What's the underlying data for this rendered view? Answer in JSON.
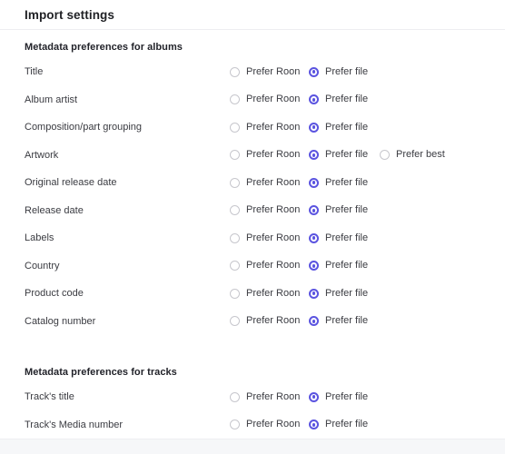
{
  "header": {
    "title": "Import settings"
  },
  "sections": [
    {
      "heading": "Metadata preferences for albums",
      "rows": [
        {
          "label": "Title",
          "options": [
            {
              "label": "Prefer Roon",
              "selected": false
            },
            {
              "label": "Prefer file",
              "selected": true
            }
          ]
        },
        {
          "label": "Album artist",
          "options": [
            {
              "label": "Prefer Roon",
              "selected": false
            },
            {
              "label": "Prefer file",
              "selected": true
            }
          ]
        },
        {
          "label": "Composition/part grouping",
          "options": [
            {
              "label": "Prefer Roon",
              "selected": false
            },
            {
              "label": "Prefer file",
              "selected": true
            }
          ]
        },
        {
          "label": "Artwork",
          "options": [
            {
              "label": "Prefer Roon",
              "selected": false
            },
            {
              "label": "Prefer file",
              "selected": true
            },
            {
              "label": "Prefer best",
              "selected": false
            }
          ]
        },
        {
          "label": "Original release date",
          "options": [
            {
              "label": "Prefer Roon",
              "selected": false
            },
            {
              "label": "Prefer file",
              "selected": true
            }
          ]
        },
        {
          "label": "Release date",
          "options": [
            {
              "label": "Prefer Roon",
              "selected": false
            },
            {
              "label": "Prefer file",
              "selected": true
            }
          ]
        },
        {
          "label": "Labels",
          "options": [
            {
              "label": "Prefer Roon",
              "selected": false
            },
            {
              "label": "Prefer file",
              "selected": true
            }
          ]
        },
        {
          "label": "Country",
          "options": [
            {
              "label": "Prefer Roon",
              "selected": false
            },
            {
              "label": "Prefer file",
              "selected": true
            }
          ]
        },
        {
          "label": "Product code",
          "options": [
            {
              "label": "Prefer Roon",
              "selected": false
            },
            {
              "label": "Prefer file",
              "selected": true
            }
          ]
        },
        {
          "label": "Catalog number",
          "options": [
            {
              "label": "Prefer Roon",
              "selected": false
            },
            {
              "label": "Prefer file",
              "selected": true
            }
          ]
        }
      ]
    },
    {
      "heading": "Metadata preferences for tracks",
      "rows": [
        {
          "label": "Track's title",
          "options": [
            {
              "label": "Prefer Roon",
              "selected": false
            },
            {
              "label": "Prefer file",
              "selected": true
            }
          ]
        },
        {
          "label": "Track's Media number",
          "options": [
            {
              "label": "Prefer Roon",
              "selected": false
            },
            {
              "label": "Prefer file",
              "selected": true
            }
          ]
        }
      ]
    }
  ],
  "colors": {
    "accent": "#5b54e0",
    "radio_unselected_border": "#c7c7cd",
    "text_primary": "#1f2024",
    "text_body": "#3a3b41",
    "divider": "#eeeef1",
    "footer_background": "#f6f7f9",
    "panel_background": "#ffffff"
  }
}
